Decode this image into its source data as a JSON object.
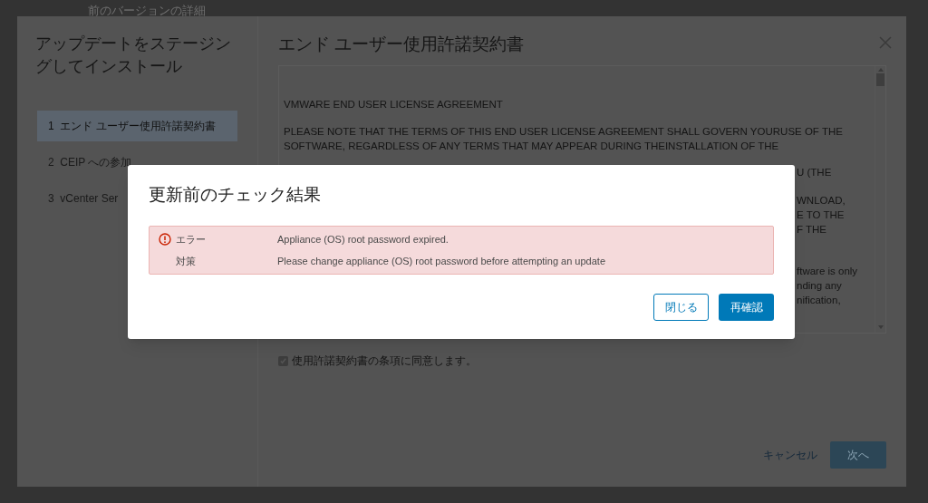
{
  "background": {
    "heading": "前のバージョンの詳細"
  },
  "wizard": {
    "title": "アップデートをステージングしてインストール",
    "steps": [
      {
        "number": "1",
        "label": "エンド ユーザー使用許諾契約書",
        "selected": true
      },
      {
        "number": "2",
        "label": "CEIP への参加",
        "selected": false
      },
      {
        "number": "3",
        "label": "vCenter Ser",
        "selected": false
      }
    ],
    "page_title": "エンド ユーザー使用許諾契約書",
    "license_lines": [
      "VMWARE END USER LICENSE AGREEMENT",
      "PLEASE NOTE THAT THE TERMS OF THIS END USER LICENSE AGREEMENT SHALL GOVERN YOURUSE OF THE SOFTWARE, REGARDLESS OF ANY TERMS THAT MAY APPEAR DURING THEINSTALLATION OF THE"
    ],
    "license_fragment_groups": [
      [
        "U (THE"
      ],
      [
        "WNLOAD,",
        "E TO THE",
        "F THE"
      ],
      [
        "ftware is only",
        "nding any",
        "nification,"
      ]
    ],
    "agree": {
      "label": "使用許諾契約書の条項に同意します。",
      "checked": true
    },
    "buttons": [
      "キャンセル",
      "次へ"
    ]
  },
  "dialog": {
    "title": "更新前のチェック結果",
    "alert": [
      {
        "kind": "error",
        "label": "エラー",
        "text": "Appliance (OS) root password expired."
      },
      {
        "kind": "resolution",
        "label": "対策",
        "text": "Please change appliance (OS) root password before attempting an update"
      }
    ],
    "buttons": [
      "閉じる",
      "再確認"
    ]
  }
}
